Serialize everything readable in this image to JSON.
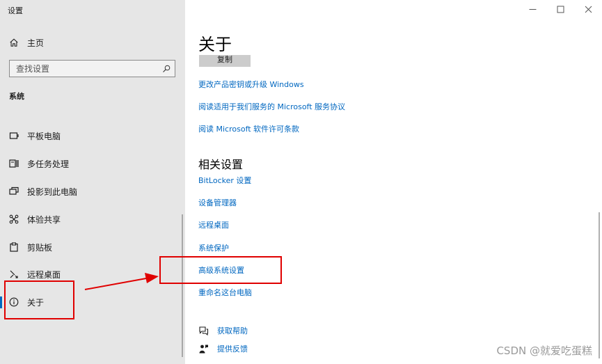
{
  "sidebar": {
    "app_title": "设置",
    "home_label": "主页",
    "search_placeholder": "查找设置",
    "section_label": "系统",
    "items": [
      {
        "label": "平板电脑",
        "icon": "tablet-icon"
      },
      {
        "label": "多任务处理",
        "icon": "multitasking-icon"
      },
      {
        "label": "投影到此电脑",
        "icon": "project-icon"
      },
      {
        "label": "体验共享",
        "icon": "shared-experiences-icon"
      },
      {
        "label": "剪贴板",
        "icon": "clipboard-icon"
      },
      {
        "label": "远程桌面",
        "icon": "remote-desktop-icon"
      },
      {
        "label": "关于",
        "icon": "info-icon",
        "active": true
      }
    ]
  },
  "main": {
    "title": "关于",
    "copy_button": "复制",
    "links": [
      "更改产品密钥或升级 Windows",
      "阅读适用于我们服务的 Microsoft 服务协议",
      "阅读 Microsoft 软件许可条款"
    ],
    "related_title": "相关设置",
    "related_links": [
      "BitLocker 设置",
      "设备管理器",
      "远程桌面",
      "系统保护",
      "高级系统设置",
      "重命名这台电脑"
    ],
    "help_label": "获取帮助",
    "feedback_label": "提供反馈"
  },
  "watermark": "CSDN @就爱吃蛋糕",
  "colors": {
    "accent": "#0067c0",
    "annotation": "#e00000",
    "sidebar_bg": "#e6e6e6"
  }
}
